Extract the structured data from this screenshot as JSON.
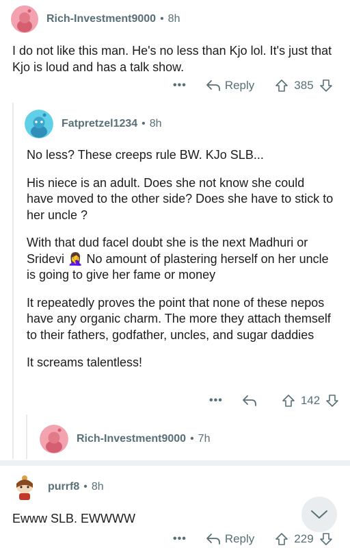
{
  "comments": [
    {
      "username": "Rich-Investment9000",
      "time": "8h",
      "paragraphs": [
        "I do not like this man. He's no less than Kjo lol. It's just that Kjo is loud and has a talk show."
      ],
      "more": "•••",
      "reply_label": "Reply",
      "votes": "385",
      "avatar_color": "#f3a3b0"
    },
    {
      "username": "Fatpretzel1234",
      "time": "8h",
      "paragraphs": [
        "No less? These creeps rule BW. KJo SLB...",
        "His niece is an adult. Does she not know she could have moved to the other side? Does she have to stick to her uncle ?",
        "With that dud facel doubt she is the next Madhuri or Sridevi",
        "No amount of plastering herself on her uncle is going to give her fame or money",
        "It repeatedly proves the point that none of these nepos have any organic charm. The more they attach themself to their fathers, godfather, uncles, and sugar daddies",
        "It screams talentless!"
      ],
      "emoji": "🤦‍♀️",
      "more": "•••",
      "votes": "142",
      "avatar_color": "#5fd0e8"
    },
    {
      "username": "Rich-Investment9000",
      "time": "7h",
      "avatar_color": "#f3a3b0"
    },
    {
      "username": "purrf8",
      "time": "8h",
      "paragraphs": [
        "Ewww SLB. EWWWW"
      ],
      "more": "•••",
      "reply_label": "Reply",
      "votes": "229"
    }
  ],
  "icons": {
    "reply": "reply-arrow-icon",
    "upvote": "upvote-arrow-icon",
    "downvote": "downvote-arrow-icon",
    "scroll": "chevron-down-icon"
  },
  "colors": {
    "meta_gray": "#576f76",
    "text": "#1c1c1c",
    "thread_line": "#e5ebee"
  }
}
